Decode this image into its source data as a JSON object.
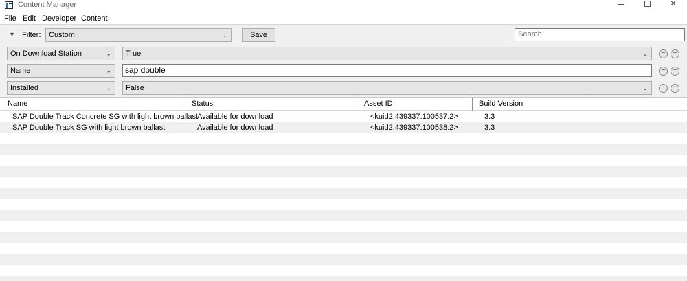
{
  "window": {
    "title": "Content Manager",
    "controls": {
      "minimize": "minimize",
      "maximize": "maximize",
      "close": "✕"
    }
  },
  "menu": [
    "File",
    "Edit",
    "Developer",
    "Content"
  ],
  "filter": {
    "toggle_icon": "▼",
    "label": "Filter:",
    "selected": "Custom...",
    "save_label": "Save",
    "search_placeholder": "Search",
    "criteria": [
      {
        "field": "On Download Station",
        "value": "True",
        "type": "select"
      },
      {
        "field": "Name",
        "value": "sap double",
        "type": "text"
      },
      {
        "field": "Installed",
        "value": "False",
        "type": "select"
      }
    ],
    "remove_icon": "−",
    "add_icon": "+"
  },
  "table": {
    "columns": [
      "Name",
      "Status",
      "Asset ID",
      "Build Version"
    ],
    "rows": [
      {
        "name": "SAP Double Track Concrete SG with light brown ballast",
        "status": "Available for download",
        "asset_id": "<kuid2:439337:100537:2>",
        "build": "3.3"
      },
      {
        "name": "SAP Double Track SG with light brown ballast",
        "status": "Available for download",
        "asset_id": "<kuid2:439337:100538:2>",
        "build": "3.3"
      }
    ]
  }
}
